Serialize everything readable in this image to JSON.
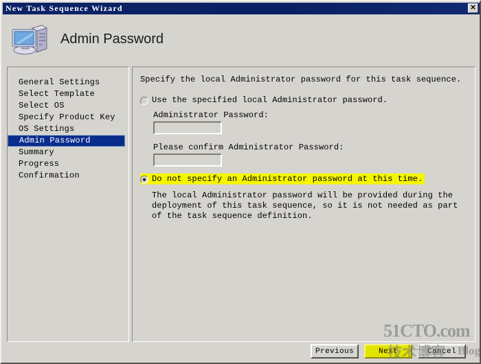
{
  "window": {
    "title": "New Task Sequence Wizard",
    "close_label": "✕"
  },
  "header": {
    "title": "Admin Password",
    "icon": "computer-icon"
  },
  "sidebar": {
    "items": [
      {
        "label": "General Settings",
        "selected": false
      },
      {
        "label": "Select Template",
        "selected": false
      },
      {
        "label": "Select OS",
        "selected": false
      },
      {
        "label": "Specify Product Key",
        "selected": false
      },
      {
        "label": "OS Settings",
        "selected": false
      },
      {
        "label": "Admin Password",
        "selected": true
      },
      {
        "label": "Summary",
        "selected": false
      },
      {
        "label": "Progress",
        "selected": false
      },
      {
        "label": "Confirmation",
        "selected": false
      }
    ]
  },
  "content": {
    "intro": "Specify the local Administrator password for this task sequence.",
    "option_specified": {
      "label": "Use the specified local Administrator password.",
      "selected": false
    },
    "password_label": "Administrator Password:",
    "password_value": "",
    "confirm_label": "Please confirm Administrator Password:",
    "confirm_value": "",
    "option_nospecify": {
      "label": "Do not specify an Administrator password at this time.",
      "selected": true,
      "highlight_color": "#f5f500"
    },
    "nospecify_description": "The local Administrator password will be provided during the deployment of this task sequence, so it is not needed as part of the task sequence definition."
  },
  "buttons": {
    "previous": "Previous",
    "next": "Next",
    "cancel": "Cancel",
    "next_highlight_color": "#e3e300"
  },
  "watermark": {
    "main": "51CTO.com",
    "chinese": "技术博客",
    "blog": "Blog"
  },
  "colors": {
    "titlebar": "#0a2064",
    "window_face": "#d6d4cf",
    "selection": "#0a2c8c",
    "highlight": "#f5f500"
  }
}
